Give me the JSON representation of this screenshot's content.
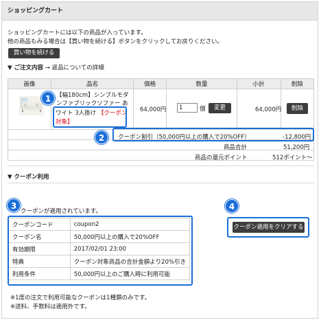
{
  "header": {
    "title": "ショッピングカート"
  },
  "intro": {
    "line1": "ショッピングカートには以下の商品が入っています。",
    "line2": "他の商品もみる場合は【買い物を続ける】ボタンをクリックしてお戻りください。",
    "continue_button": "買い物を続ける"
  },
  "order": {
    "title": "▼ ご注文内容",
    "arrow": "→",
    "return_link": "返品についての詳細"
  },
  "cart": {
    "columns": [
      "画像",
      "品名",
      "価格",
      "数量",
      "小計",
      "削除"
    ],
    "item": {
      "name_line1": "【幅180cm】シンプルモダ",
      "name_line2": "ンファブリックソファー  あ",
      "name_line3": "ワイト 3人掛け",
      "coupon_tag_1": "【クーポン",
      "coupon_tag_2": "対象】",
      "price": "64,000円",
      "quantity": "1",
      "quantity_unit": "個",
      "change_button": "変更",
      "subtotal": "64,000円",
      "delete_button": "削除"
    },
    "discount_label": "クーポン割引（50,000円以上の購入で20%OFF）",
    "discount_value": "-12,800円",
    "total_label": "商品合計",
    "total_value": "51,200円",
    "points_label": "商品の還元ポイント",
    "points_value": "512ポイント〜"
  },
  "coupon": {
    "title": "▼ クーポン利用",
    "applied_text": "クーポンが適用されています。",
    "clear_button": "クーポン適用をクリアする",
    "rows": [
      {
        "key": "クーポンコード",
        "value": "coupon2"
      },
      {
        "key": "クーポン名",
        "value": "50,000円以上の購入で20%OFF"
      },
      {
        "key": "有効期限",
        "value": "2017/02/01 23:00"
      },
      {
        "key": "特典",
        "value": "クーポン対象商品の合計金額より20%引き"
      },
      {
        "key": "利用条件",
        "value": "50,000円以上のご購入時に利用可能"
      }
    ],
    "note1": "※1度の注文で利用可能なクーポンは1種類のみです。",
    "note2": "※送料、手数料は適用外です。"
  },
  "badges": [
    "1",
    "2",
    "3",
    "4"
  ],
  "colors": {
    "highlight": "#1a6ed8",
    "coupon_tag": "#e0001a",
    "button": "#3d3d3d",
    "header_bg": "#e8e8e8"
  }
}
